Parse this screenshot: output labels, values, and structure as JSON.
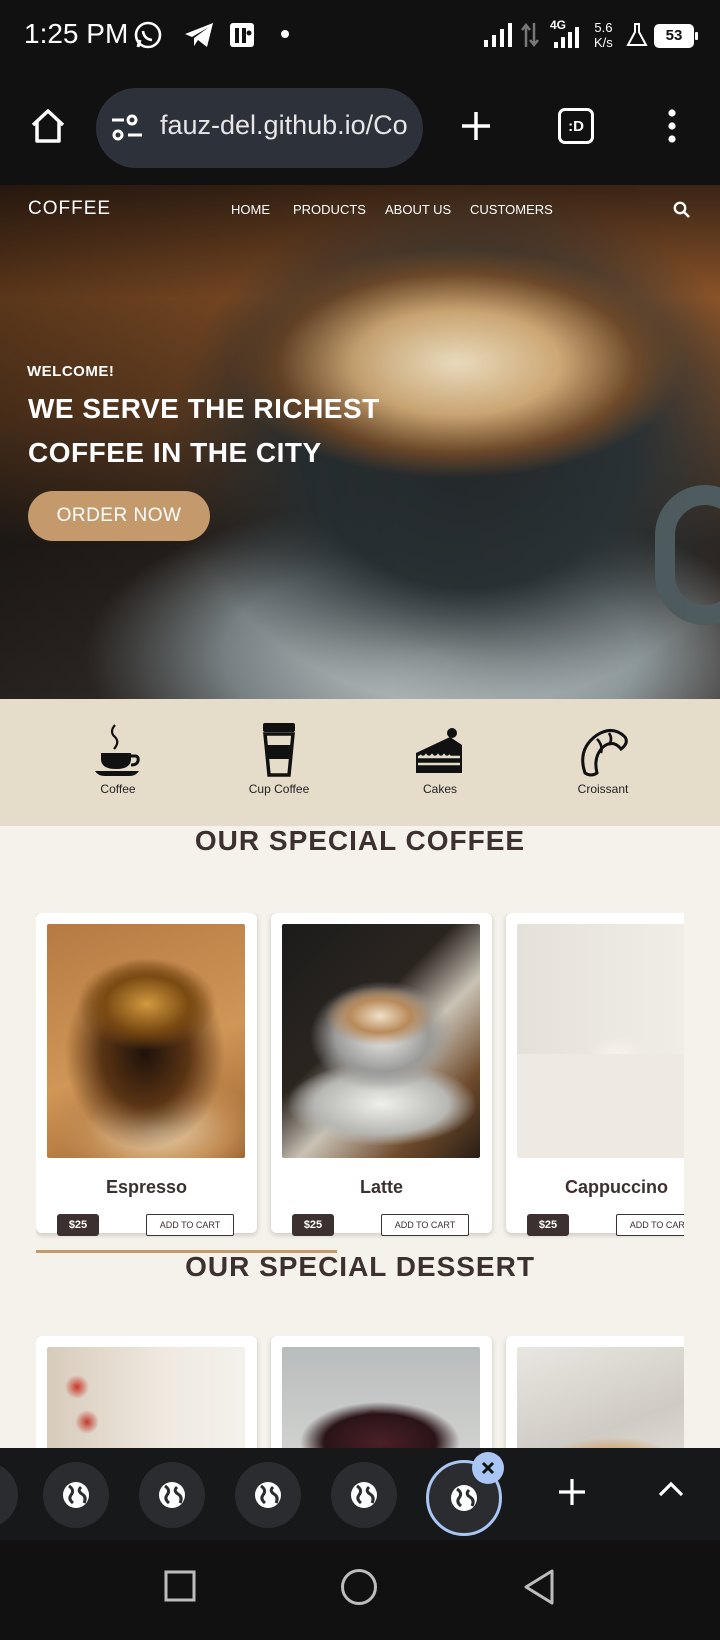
{
  "status_bar": {
    "time": "1:25 PM",
    "network": "4G",
    "speed_value": "5.6",
    "speed_unit": "K/s",
    "battery": "53"
  },
  "browser": {
    "url": "fauz-del.github.io/Co",
    "tab_switch_label": ":D"
  },
  "site": {
    "logo": "COFFEE",
    "nav": [
      "HOME",
      "PRODUCTS",
      "ABOUT US",
      "CUSTOMERS"
    ],
    "welcome": "WELCOME!",
    "headline_line1": "WE SERVE THE RICHEST",
    "headline_line2": "COFFEE IN THE CITY",
    "cta": "ORDER NOW",
    "categories": [
      {
        "label": "Coffee",
        "icon": "coffee-cup-icon"
      },
      {
        "label": "Cup Coffee",
        "icon": "takeaway-cup-icon"
      },
      {
        "label": "Cakes",
        "icon": "cake-icon"
      },
      {
        "label": "Croissant",
        "icon": "croissant-icon"
      }
    ],
    "coffee_section_title": "OUR SPECIAL COFFEE",
    "coffee_products": [
      {
        "name": "Espresso",
        "price": "$25",
        "button": "ADD TO CART"
      },
      {
        "name": "Latte",
        "price": "$25",
        "button": "ADD TO CART"
      },
      {
        "name": "Cappuccino",
        "price": "$25",
        "button": "ADD TO CART"
      }
    ],
    "dessert_section_title": "OUR SPECIAL DESSERT"
  },
  "colors": {
    "accent": "#c49a6c",
    "dark_brown": "#3d3030",
    "page_bg": "#f4f2ea",
    "category_bg": "#e5dcca",
    "tab_highlight": "#a9c6f5"
  }
}
